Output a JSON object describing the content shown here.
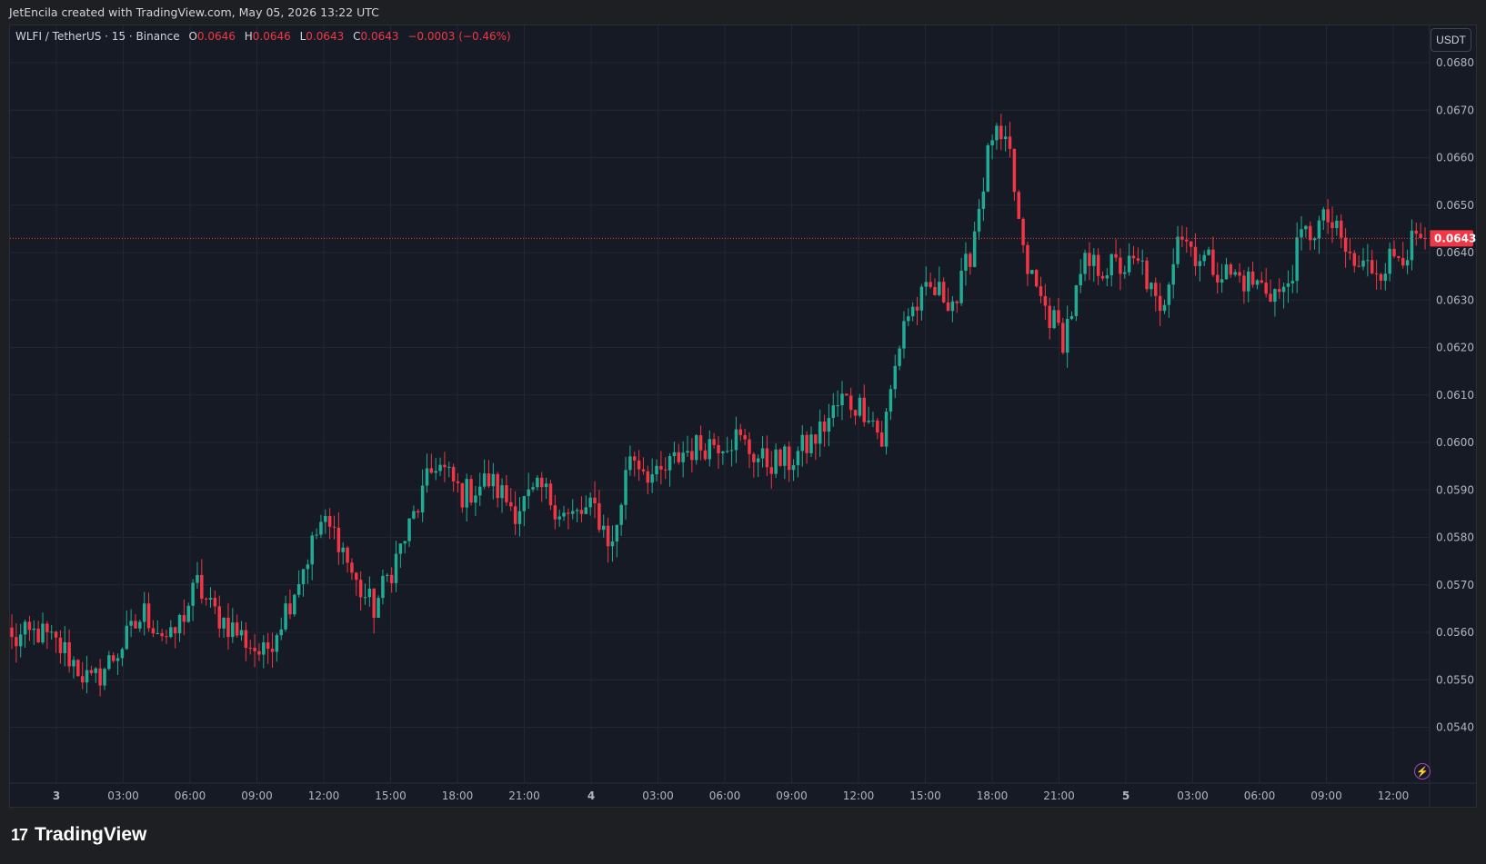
{
  "header": {
    "text": "JetEncila created with TradingView.com, May 05, 2026 13:22 UTC"
  },
  "legend": {
    "symbol": "WLFI / TetherUS · 15 · Binance",
    "o_label": "O",
    "o_value": "0.0646",
    "h_label": "H",
    "h_value": "0.0646",
    "l_label": "L",
    "l_value": "0.0643",
    "c_label": "C",
    "c_value": "0.0643",
    "change": "−0.0003 (−0.46%)"
  },
  "unit_button": "USDT",
  "footer": {
    "brand": "TradingView",
    "logo_mark": "17"
  },
  "colors": {
    "up": "#22ab94",
    "down": "#f23645",
    "background": "#161a25",
    "grid": "#232733",
    "axis_text": "#b2b5be"
  },
  "chart_data": {
    "type": "candlestick",
    "title": "WLFI / TetherUS · 15 · Binance",
    "ylim": [
      0.0535,
      0.0686
    ],
    "y_ticks": [
      "0.0680",
      "0.0670",
      "0.0660",
      "0.0650",
      "0.0640",
      "0.0630",
      "0.0620",
      "0.0610",
      "0.0600",
      "0.0590",
      "0.0580",
      "0.0570",
      "0.0560",
      "0.0550",
      "0.0540"
    ],
    "x_ticks": [
      "3",
      "03:00",
      "06:00",
      "09:00",
      "12:00",
      "15:00",
      "18:00",
      "21:00",
      "4",
      "03:00",
      "06:00",
      "09:00",
      "12:00",
      "15:00",
      "18:00",
      "21:00",
      "5",
      "03:00",
      "06:00",
      "09:00",
      "12:00"
    ],
    "current_price": "0.0643",
    "grid": true,
    "anchors": [
      [
        0,
        0.0558
      ],
      [
        6,
        0.056
      ],
      [
        12,
        0.0556
      ],
      [
        18,
        0.0549
      ],
      [
        24,
        0.0556
      ],
      [
        30,
        0.0564
      ],
      [
        36,
        0.0558
      ],
      [
        42,
        0.057
      ],
      [
        45,
        0.0565
      ],
      [
        51,
        0.056
      ],
      [
        57,
        0.0555
      ],
      [
        63,
        0.0567
      ],
      [
        70,
        0.0583
      ],
      [
        74,
        0.058
      ],
      [
        78,
        0.057
      ],
      [
        82,
        0.0565
      ],
      [
        90,
        0.0582
      ],
      [
        96,
        0.0596
      ],
      [
        102,
        0.0589
      ],
      [
        108,
        0.0592
      ],
      [
        114,
        0.0586
      ],
      [
        120,
        0.059
      ],
      [
        126,
        0.0584
      ],
      [
        132,
        0.0586
      ],
      [
        136,
        0.0578
      ],
      [
        140,
        0.0598
      ],
      [
        146,
        0.0592
      ],
      [
        152,
        0.0598
      ],
      [
        158,
        0.06
      ],
      [
        164,
        0.0601
      ],
      [
        170,
        0.0596
      ],
      [
        176,
        0.0596
      ],
      [
        182,
        0.0601
      ],
      [
        188,
        0.0609
      ],
      [
        194,
        0.0607
      ],
      [
        197,
        0.06
      ],
      [
        202,
        0.0626
      ],
      [
        208,
        0.0632
      ],
      [
        214,
        0.063
      ],
      [
        217,
        0.064
      ],
      [
        222,
        0.0665
      ],
      [
        226,
        0.066
      ],
      [
        229,
        0.0639
      ],
      [
        233,
        0.063
      ],
      [
        238,
        0.0622
      ],
      [
        243,
        0.0637
      ],
      [
        250,
        0.0637
      ],
      [
        256,
        0.0637
      ],
      [
        260,
        0.0626
      ],
      [
        264,
        0.0645
      ],
      [
        268,
        0.064
      ],
      [
        274,
        0.0636
      ],
      [
        280,
        0.0634
      ],
      [
        288,
        0.0631
      ],
      [
        292,
        0.0643
      ],
      [
        298,
        0.0647
      ],
      [
        304,
        0.0637
      ],
      [
        310,
        0.0637
      ],
      [
        314,
        0.064
      ],
      [
        320,
        0.0643
      ]
    ]
  }
}
